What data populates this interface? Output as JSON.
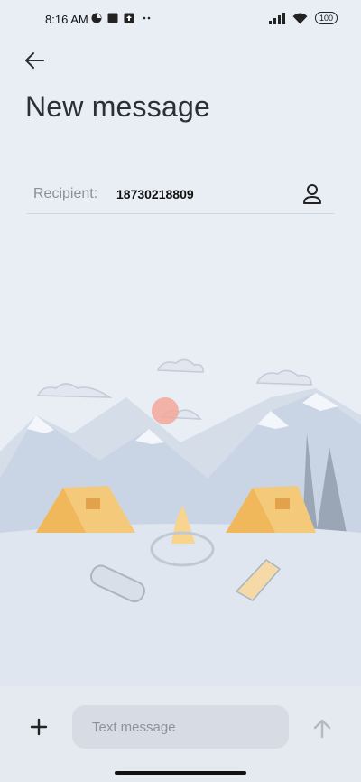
{
  "status_bar": {
    "time": "8:16 AM",
    "left_icons": [
      "pie-chart-icon",
      "square-app-icon",
      "upload-app-icon",
      "more-dots-icon"
    ],
    "right_icons": [
      "signal-icon",
      "wifi-icon"
    ],
    "battery": "100"
  },
  "header": {
    "back_icon": "back-arrow-icon",
    "title": "New message"
  },
  "recipient": {
    "label": "Recipient:",
    "value": "18730218809",
    "contact_icon": "person-icon"
  },
  "illustration": {
    "description_icon": "camping-mountain-scene"
  },
  "composer": {
    "add_icon": "plus-icon",
    "placeholder": "Text message",
    "send_icon": "send-arrow-icon"
  },
  "colors": {
    "background": "#e9edf4",
    "tent": "#f5c97a",
    "sun": "#f4a79a",
    "mountain": "#c9d4e4"
  }
}
